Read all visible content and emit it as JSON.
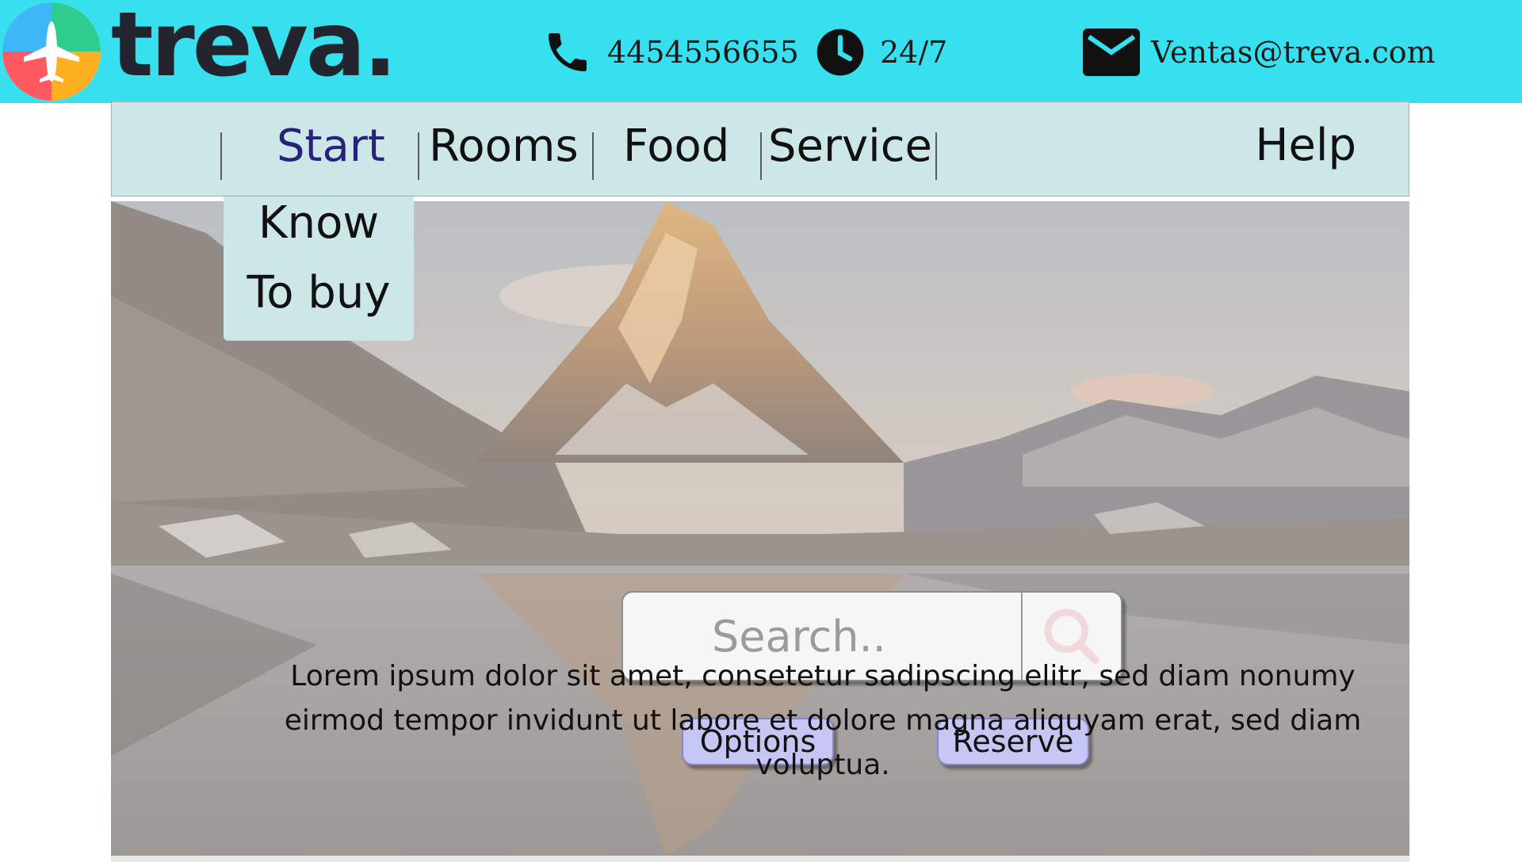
{
  "brand": {
    "name": "treva."
  },
  "header": {
    "phone": "4454556655",
    "hours": "24/7",
    "email": "Ventas@treva.com"
  },
  "nav": {
    "items": [
      {
        "label": "Start",
        "active": true
      },
      {
        "label": "Rooms"
      },
      {
        "label": "Food"
      },
      {
        "label": "Service"
      }
    ],
    "help": "Help",
    "dropdown": [
      "Know",
      "To buy"
    ]
  },
  "search": {
    "placeholder": "Search.."
  },
  "buttons": {
    "options": "Options",
    "reserve": "Reserve"
  },
  "hero": {
    "text": "Lorem ipsum dolor sit amet, consetetur  sadipscing elitr, sed diam nonumy eirmod tempor invidunt ut labore et dolore magna  aliquyam erat, sed diam voluptua."
  },
  "colors": {
    "topbar": "#37e0ee",
    "nav": "#cde6e8",
    "active_nav": "#28237a",
    "button": "#c6c6f4"
  },
  "icons": [
    "phone-icon",
    "clock-icon",
    "mail-icon",
    "search-icon",
    "logo-icon"
  ]
}
